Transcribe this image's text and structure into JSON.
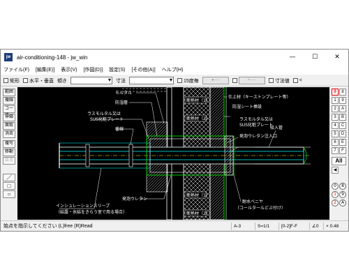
{
  "window": {
    "title": "air-conditioning-148 - jw_win",
    "icon_text": "jw",
    "controls": {
      "minimize": "—",
      "maximize": "☐",
      "close": "✕"
    }
  },
  "menu": [
    "ファイル(F)",
    "[編集(E)]",
    "表示(V)",
    "[作図(D)]",
    "設定(S)",
    "[その他(A)]",
    "ヘルプ(H)"
  ],
  "toolbar": {
    "rect_label": "矩形",
    "hv_label": "水平・垂直",
    "slope_label": "傾き",
    "dim_label": "寸法",
    "deg15_label": "15度毎",
    "pick_a": "●----",
    "pick_b": "<----",
    "dimval_label": "寸法値",
    "lt_label": "<"
  },
  "left_tools": [
    "範囲",
    "複線",
    "コーナー",
    "伸縮",
    "面取",
    "消去",
    "複写",
    "移動",
    "戻る"
  ],
  "right_tools": {
    "rows": [
      [
        "0",
        "8"
      ],
      [
        "1",
        "9"
      ],
      [
        "2",
        "A"
      ],
      [
        "3",
        "B"
      ],
      [
        "4",
        "C"
      ],
      [
        "5",
        "D"
      ],
      [
        "6",
        "E"
      ],
      [
        "7",
        "F"
      ]
    ],
    "all_label": "All",
    "circle_rows": [
      [
        "0",
        "8"
      ],
      [
        "1",
        "9"
      ],
      [
        "2",
        "A"
      ]
    ]
  },
  "drawing": {
    "labels": {
      "mortar": "モルタル",
      "waterproof": "防湿層",
      "lath_sus1_a": "ラスモルタル又は",
      "lath_sus1_b": "SUS化粧プレート",
      "fixing": "番線",
      "foam_urethane": "発泡ウレタン",
      "sleeve_a": "インシュレーションスリーブ",
      "sleeve_b": "（結露・氷結をきらう室で用る場合）",
      "insul_top_1": "断熱材（1）",
      "insul_top_2": "断熱材（2）",
      "insul_bottom_1": "断熱材（1）",
      "insul_bottom_2": "断熱材（2）",
      "finish": "仕上材（キーストンプレート等）",
      "moisture_sheet": "防湿シート棒設",
      "lath_sus2_a": "ラスモルタル又は",
      "lath_sus2_b": "SUS化粧プレート",
      "urethane_inlet": "発泡ウレタン注入口",
      "suction_pipe": "吸入管",
      "plywood_a": "耐水ベニヤ",
      "plywood_b": "（コールタールどぶ付け）"
    }
  },
  "status": {
    "message": "始点を指示してください (L)free (R)Read",
    "sheet": "A-3",
    "scale": "S=1/1",
    "layer": "[0-2]F-F",
    "angle": "∠0",
    "zoom": "× 0.48"
  },
  "colors": {
    "canvas_bg": "#000000",
    "line_white": "#ffffff",
    "line_cyan": "#00e5e5",
    "line_green": "#00d000",
    "line_yellow": "#ffff00",
    "accent_red": "#dd0000"
  }
}
